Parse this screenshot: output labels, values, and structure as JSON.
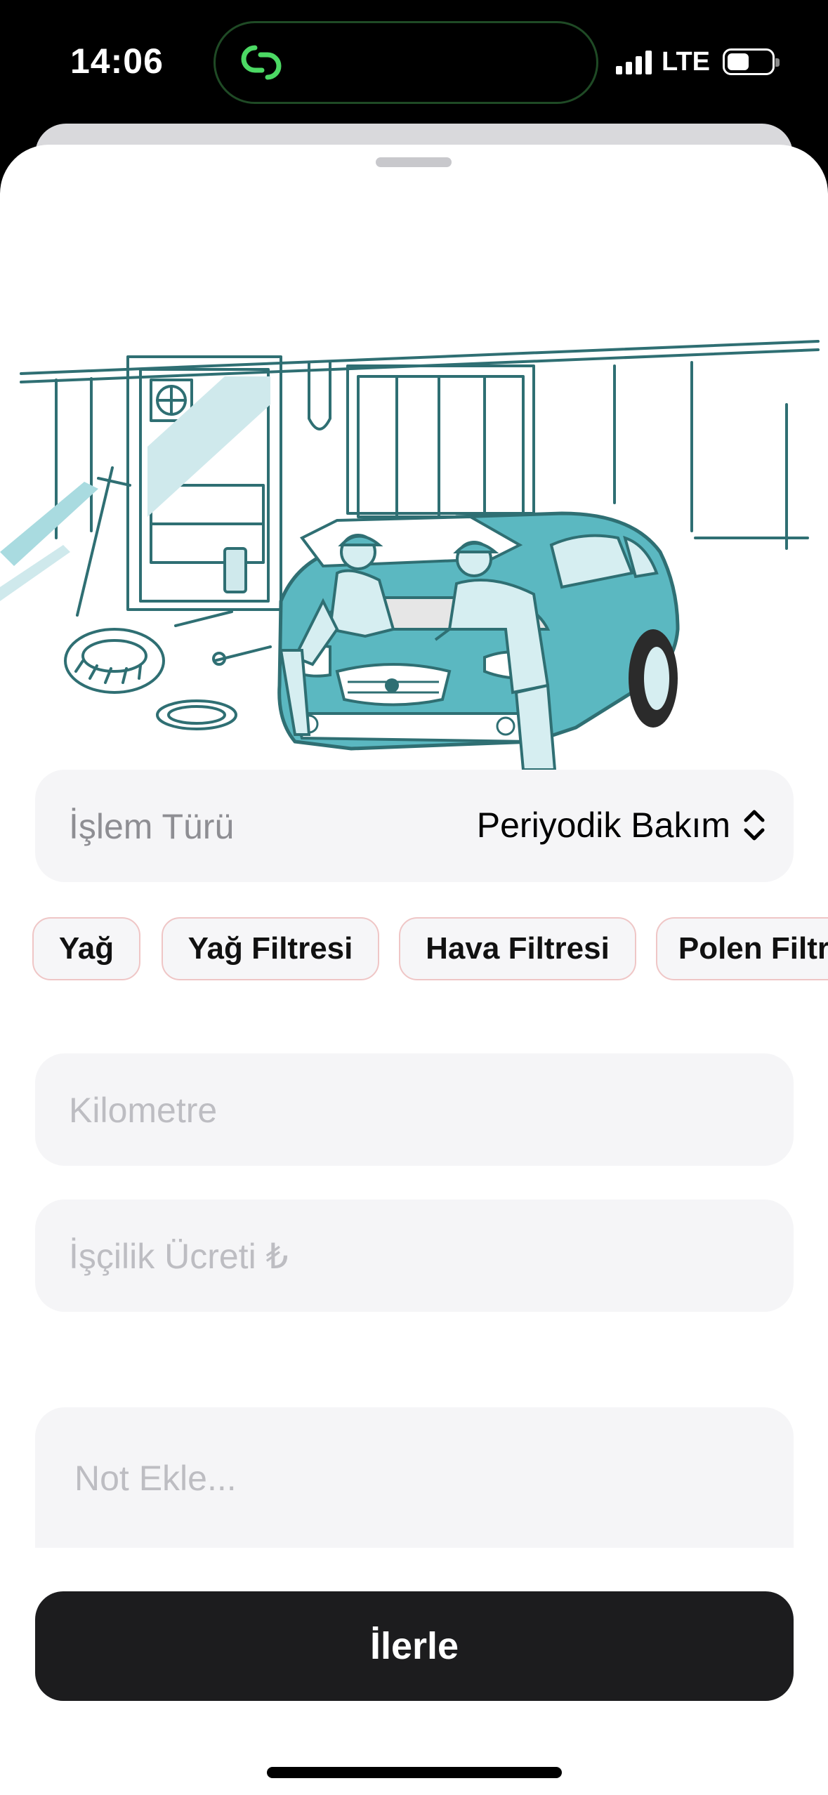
{
  "status_bar": {
    "time": "14:06",
    "network": "LTE",
    "icons": [
      "activity-link-icon",
      "signal-bars-icon",
      "battery-icon"
    ]
  },
  "illustration": {
    "subject": "mechanics servicing a teal car in a garage",
    "accent_color": "#5bb8c1",
    "line_color": "#2f6f73"
  },
  "form": {
    "operation_type": {
      "label": "İşlem Türü",
      "value": "Periyodik Bakım"
    },
    "chips": [
      {
        "label": "Yağ"
      },
      {
        "label": "Yağ Filtresi"
      },
      {
        "label": "Hava Filtresi"
      },
      {
        "label": "Polen Filtresi"
      }
    ],
    "kilometer": {
      "placeholder": "Kilometre"
    },
    "labor_cost": {
      "placeholder": "İşçilik Ücreti ₺"
    },
    "note": {
      "placeholder": "Not Ekle..."
    },
    "submit_label": "İlerle"
  },
  "colors": {
    "chip_border": "#efc6c6",
    "field_background": "#f5f5f7",
    "button_background": "#1c1c1e",
    "island_accent": "#4cd964"
  }
}
